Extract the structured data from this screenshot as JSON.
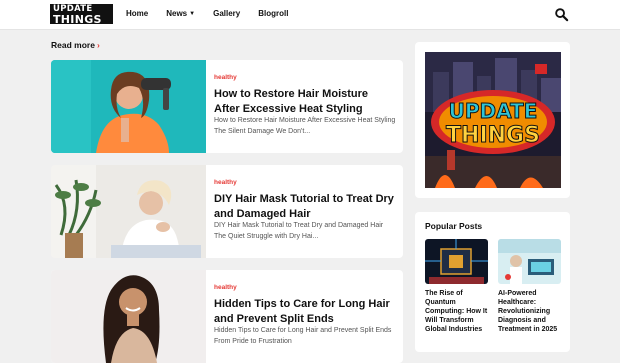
{
  "header": {
    "logo_line1": "UPDATE",
    "logo_line2": "THINGS",
    "nav": [
      {
        "label": "Home"
      },
      {
        "label": "News"
      },
      {
        "label": "Gallery"
      },
      {
        "label": "Blogroll"
      }
    ],
    "search_icon": "search-icon"
  },
  "main": {
    "read_more": "Read more",
    "posts": [
      {
        "category": "healthy",
        "title": "How to Restore Hair Moisture After Excessive Heat Styling",
        "snippet": "How to Restore Hair Moisture After Excessive Heat Styling The Silent Damage We Don't..."
      },
      {
        "category": "healthy",
        "title": "DIY Hair Mask Tutorial to Treat Dry and Damaged Hair",
        "snippet": "DIY Hair Mask Tutorial to Treat Dry and Damaged Hair The Quiet Struggle with Dry Hai..."
      },
      {
        "category": "healthy",
        "title": "Hidden Tips to Care for Long Hair and Prevent Split Ends",
        "snippet": "Hidden Tips to Care for Long Hair and Prevent Split Ends From Pride to Frustration"
      }
    ]
  },
  "sidebar": {
    "banner_text_line1": "UPDATE",
    "banner_text_line2": "THINGS",
    "popular_title": "Popular Posts",
    "popular": [
      {
        "title": "The Rise of Quantum Computing: How It Will Transform Global Industries"
      },
      {
        "title": "AI-Powered Healthcare: Revolutionizing Diagnosis and Treatment in 2025"
      }
    ]
  },
  "colors": {
    "accent": "#e53935",
    "page_bg": "#f0f0f0",
    "text": "#111111"
  }
}
